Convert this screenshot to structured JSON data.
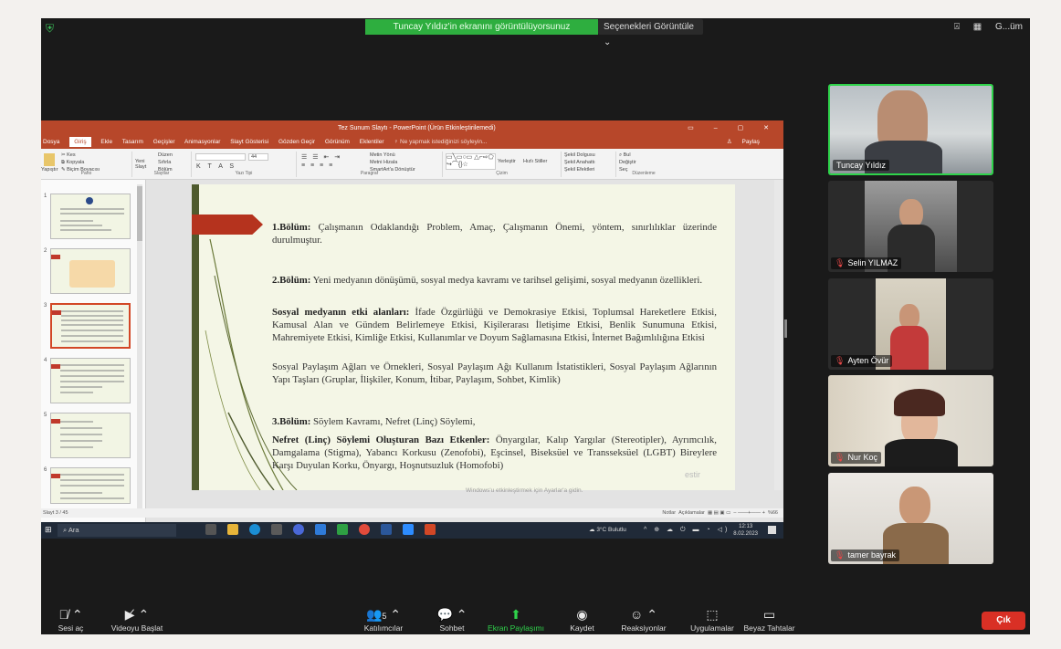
{
  "zoom": {
    "share_banner": "Tuncay Yıldız'in ekranını görüntülüyorsunuz",
    "view_options": "Seçenekleri Görüntüle",
    "top_right_label": "G...üm",
    "participants": [
      {
        "name": "Tuncay Yıldız",
        "muted": false,
        "speaking": true
      },
      {
        "name": "Selin YILMAZ",
        "muted": true,
        "speaking": false
      },
      {
        "name": "Ayten Övür",
        "muted": true,
        "speaking": false
      },
      {
        "name": "Nur Koç",
        "muted": true,
        "speaking": false
      },
      {
        "name": "tamer bayrak",
        "muted": true,
        "speaking": false
      }
    ],
    "toolbar": {
      "audio": "Sesi aç",
      "video": "Videoyu Başlat",
      "participants": "Katılımcılar",
      "participant_count": "5",
      "chat": "Sohbet",
      "share": "Ekran Paylaşımı",
      "record": "Kaydet",
      "reactions": "Reaksiyonlar",
      "apps": "Uygulamalar",
      "whiteboards": "Beyaz Tahtalar",
      "exit": "Çık"
    }
  },
  "ppt": {
    "window_title": "Tez Sunum Slaytı - PowerPoint (Ürün Etkinleştirilemedi)",
    "menu": [
      "Dosya",
      "Giriş",
      "Ekle",
      "Tasarım",
      "Geçişler",
      "Animasyonlar",
      "Slayt Gösterisi",
      "Gözden Geçir",
      "Görünüm",
      "Eklentiler",
      "♀ Ne yapmak istediğinizi söyleyin..."
    ],
    "active_menu": "Giriş",
    "share_label": "Paylaş",
    "ribbon_groups": [
      "Pano",
      "Slaytlar",
      "Yazı Tipi",
      "Paragraf",
      "Çizim",
      "Düzenleme"
    ],
    "ribbon": {
      "cut": "Kes",
      "copy": "Kopyala",
      "format_painter": "Biçim Boyacısı",
      "paste": "Yapıştır",
      "new_slide": "Yeni Slayt",
      "layout": "Düzen",
      "reset": "Sıfırla",
      "section": "Bölüm",
      "font_size": "44",
      "text_direction": "Metin Yönü",
      "align_text": "Metni Hizala",
      "smartart": "SmartArt'a Dönüştür",
      "arrange": "Yerleştir",
      "quick_styles": "Hızlı Stiller",
      "shape_fill": "Şekil Dolgusu",
      "shape_outline": "Şekil Anahattı",
      "shape_effects": "Şekil Efektleri",
      "find": "Bul",
      "replace": "Değiştir",
      "select": "Seç"
    },
    "slide_status": "Slayt 3 / 45",
    "notes": "Notlar",
    "comments": "Açıklamalar",
    "zoom_level": "%66",
    "watermark_line1": "estir",
    "watermark_line2": "Windows'u etkinleştirmek için Ayarlar'a gidin.",
    "slide": {
      "p1_bold": "1.Bölüm:",
      "p1_text": " Çalışmanın Odaklandığı Problem, Amaç, Çalışmanın Önemi, yöntem, sınırlılıklar üzerinde durulmuştur.",
      "p2_bold": "2.Bölüm:",
      "p2_text": " Yeni medyanın dönüşümü, sosyal medya kavramı ve tarihsel gelişimi, sosyal medyanın özellikleri.",
      "p3_bold": "Sosyal medyanın etki alanları:",
      "p3_text": " İfade Özgürlüğü ve Demokrasiye Etkisi, Toplumsal Hareketlere Etkisi, Kamusal Alan ve Gündem Belirlemeye Etkisi, Kişilerarası İletişime Etkisi, Benlik Sunumuna Etkisi, Mahremiyete Etkisi, Kimliğe Etkisi, Kullanımlar ve Doyum Sağlamasına Etkisi, İnternet Bağımlılığına Etkisi",
      "p4_text": "Sosyal Paylaşım Ağları ve Örnekleri, Sosyal Paylaşım Ağı Kullanım İstatistikleri, Sosyal Paylaşım Ağlarının Yapı Taşları (Gruplar, İlişkiler, Konum, İtibar, Paylaşım, Sohbet, Kimlik)",
      "p5_bold": "3.Bölüm:",
      "p5_text": " Söylem Kavramı, Nefret (Linç) Söylemi,",
      "p6_bold": "Nefret (Linç) Söylemi Oluşturan Bazı Etkenler:",
      "p6_text": " Önyargılar, Kalıp Yargılar (Stereotipler), Ayrımcılık, Damgalama (Stigma), Yabancı Korkusu (Zenofobi), Eşcinsel, Biseksüel ve Transseksüel (LGBT) Bireylere Karşı Duyulan Korku, Önyargı, Hoşnutsuzluk (Homofobi)"
    },
    "thumbnails": [
      "1",
      "2",
      "3",
      "4",
      "5",
      "6"
    ],
    "active_thumbnail": "3"
  },
  "taskbar": {
    "search_placeholder": "Ara",
    "weather": "3°C Bulutlu",
    "time": "12:13",
    "date": "8.02.2023"
  }
}
